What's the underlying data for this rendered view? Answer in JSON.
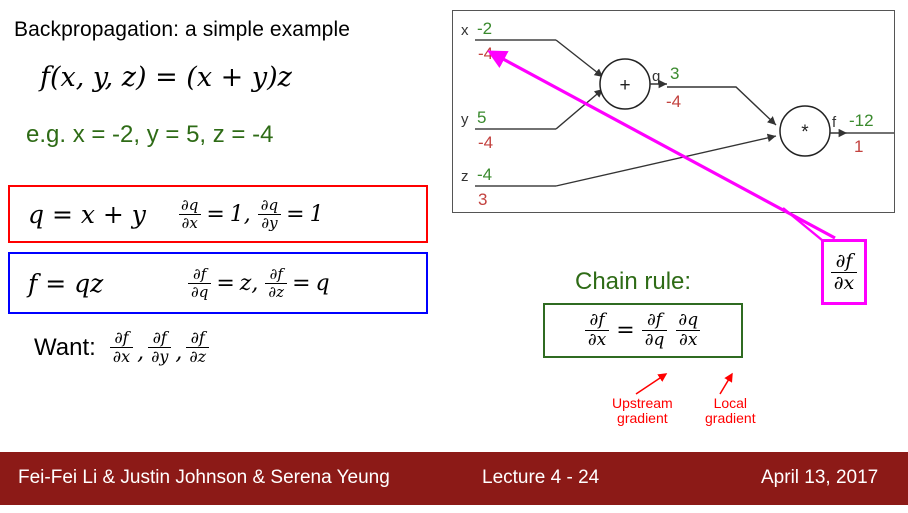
{
  "slide": {
    "title": "Backpropagation: a simple example",
    "function_line": "f(x, y, z) = (x + y)z",
    "example_line": "e.g. x = -2, y = 5, z = -4",
    "colors": {
      "forward_value": "#3a8a2e",
      "gradient_value": "#c3423f",
      "example_green": "#2E6B16",
      "q_box_border": "#ff0000",
      "f_box_border": "#0000ff",
      "chain_box_border": "#2F6B21",
      "highlight_magenta": "#ff00ff",
      "footer_background": "#8C1A17",
      "note_red": "#ff0000"
    }
  },
  "equations": {
    "q_box": {
      "lhs": "q = x + y",
      "d1_num": "∂q",
      "d1_den": "∂x",
      "d1_rhs": "1",
      "d2_num": "∂q",
      "d2_den": "∂y",
      "d2_rhs": "1",
      "separator": ",",
      "equals": "="
    },
    "f_box": {
      "lhs": "f = qz",
      "d1_num": "∂f",
      "d1_den": "∂q",
      "d1_rhs": "z",
      "d2_num": "∂f",
      "d2_den": "∂z",
      "d2_rhs": "q",
      "separator": ",",
      "equals": "="
    },
    "want": {
      "label": "Want:",
      "terms": [
        {
          "num": "∂f",
          "den": "∂x",
          "sep": ","
        },
        {
          "num": "∂f",
          "den": "∂y",
          "sep": ","
        },
        {
          "num": "∂f",
          "den": "∂z",
          "sep": ""
        }
      ]
    }
  },
  "chain_rule": {
    "title": "Chain rule:",
    "lhs_num": "∂f",
    "lhs_den": "∂x",
    "equals": "=",
    "t1_num": "∂f",
    "t1_den": "∂q",
    "t2_num": "∂q",
    "t2_den": "∂x",
    "upstream_note_line1": "Upstream",
    "upstream_note_line2": "gradient",
    "local_note_line1": "Local",
    "local_note_line2": "gradient"
  },
  "highlight_box": {
    "num": "∂f",
    "den": "∂x"
  },
  "graph": {
    "inputs": [
      {
        "name": "x",
        "value": "-2",
        "gradient": "-4"
      },
      {
        "name": "y",
        "value": "5",
        "gradient": "-4"
      },
      {
        "name": "z",
        "value": "-4",
        "gradient": "3"
      }
    ],
    "operations": [
      {
        "symbol": "+",
        "name": "add-node"
      },
      {
        "symbol": "*",
        "name": "multiply-node"
      }
    ],
    "intermediates": [
      {
        "name": "q",
        "value": "3",
        "gradient": "-4"
      }
    ],
    "output": {
      "name": "f",
      "value": "-12",
      "gradient": "1"
    }
  },
  "footer": {
    "authors": "Fei-Fei Li & Justin Johnson & Serena Yeung",
    "lecture": "Lecture 4 - 24",
    "date": "April 13, 2017"
  }
}
